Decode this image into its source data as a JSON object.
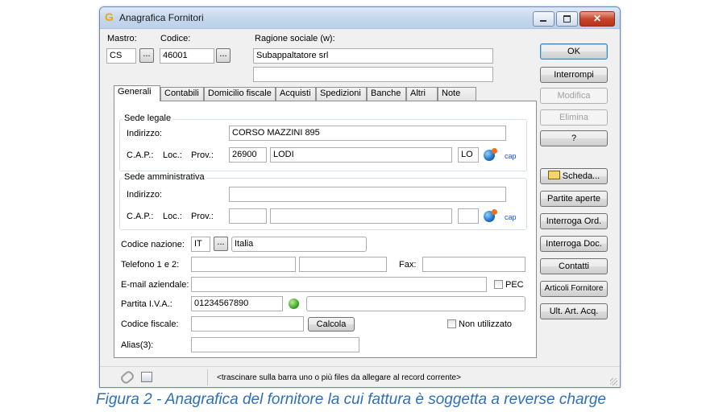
{
  "window": {
    "title": "Anagrafica Fornitori",
    "app_icon": "G"
  },
  "header": {
    "mastro_label": "Mastro:",
    "codice_label": "Codice:",
    "ragione_label": "Ragione sociale (w):",
    "mastro_value": "CS",
    "codice_value": "46001",
    "ragione_value": "Subappaltatore srl",
    "ragione_value2": "",
    "ellipsis": "..."
  },
  "side_buttons": {
    "ok": "OK",
    "interrompi": "Interrompi",
    "modifica": "Modifica",
    "elimina": "Elimina",
    "help": "?",
    "scheda": "Scheda...",
    "partite_aperte": "Partite aperte",
    "interroga_ord": "Interroga Ord.",
    "interroga_doc": "Interroga Doc.",
    "contatti": "Contatti",
    "articoli_fornitore": "Articoli Fornitore",
    "ult_art_acq": "Ult. Art. Acq."
  },
  "tabs": [
    "Generali",
    "Contabili",
    "Domicilio fiscale",
    "Acquisti",
    "Spedizioni",
    "Banche",
    "Altri",
    "Note"
  ],
  "sede_legale": {
    "title": "Sede legale",
    "indirizzo_label": "Indirizzo:",
    "indirizzo_value": "CORSO MAZZINI 895",
    "cap_label": "C.A.P.:",
    "loc_label": "Loc.:",
    "prov_label": "Prov.:",
    "cap_value": "26900",
    "loc_value": "LODI",
    "prov_value": "LO",
    "cap_link": "cap"
  },
  "sede_amministrativa": {
    "title": "Sede amministrativa",
    "indirizzo_label": "Indirizzo:",
    "indirizzo_value": "",
    "cap_label": "C.A.P.:",
    "loc_label": "Loc.:",
    "prov_label": "Prov.:",
    "cap_value": "",
    "loc_value": "",
    "prov_value": "",
    "cap_link": "cap"
  },
  "general": {
    "codice_nazione_label": "Codice nazione:",
    "codice_nazione_value": "IT",
    "nazione_value": "Italia",
    "telefono_label": "Telefono 1 e 2:",
    "telefono1_value": "",
    "telefono2_value": "",
    "fax_label": "Fax:",
    "fax_value": "",
    "email_label": "E-mail aziendale:",
    "email_value": "",
    "pec_label": "PEC",
    "piva_label": "Partita I.V.A.:",
    "piva_value": "01234567890",
    "piva_extra_value": "",
    "cf_label": "Codice fiscale:",
    "cf_value": "",
    "calcola": "Calcola",
    "non_utilizzato_label": "Non utilizzato",
    "alias_label": "Alias(3):",
    "alias_value": ""
  },
  "statusbar": {
    "hint": "<trascinare sulla barra uno o più files da allegare al record corrente>"
  },
  "caption": "Figura 2 - Anagrafica del fornitore la cui fattura è soggetta a reverse charge"
}
